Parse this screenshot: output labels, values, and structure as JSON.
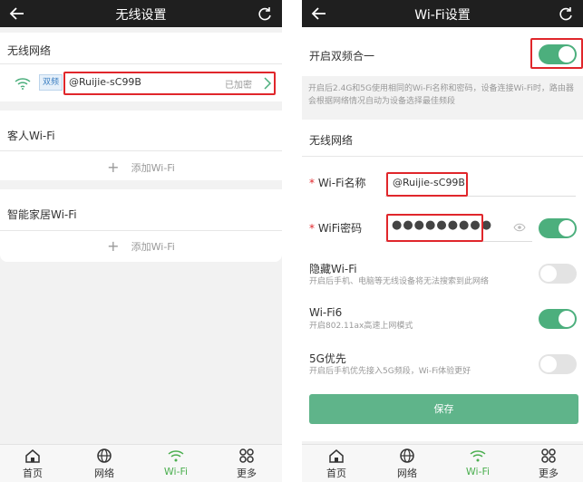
{
  "left": {
    "title": "无线设置",
    "section_wireless": "无线网络",
    "band_badge": "双频",
    "ssid": "@Ruijie-sC99B",
    "encrypted": "已加密",
    "section_guest": "客人Wi-Fi",
    "add_guest": "添加Wi-Fi",
    "section_smart": "智能家居Wi-Fi",
    "add_smart": "添加Wi-Fi"
  },
  "right": {
    "title": "Wi-Fi设置",
    "dual_band_label": "开启双频合一",
    "dual_band_desc": "开启后2.4G和5G使用相同的Wi-Fi名称和密码，设备连接Wi-Fi时，路由器会根据网络情况自动为设备选择最佳频段",
    "section_wireless": "无线网络",
    "wifi_name_label": "Wi-Fi名称",
    "wifi_name_value": "@Ruijie-sC99B",
    "wifi_pw_label": "WiFi密码",
    "wifi_pw_value": "●●●●●●●●●",
    "hide_title": "隐藏Wi-Fi",
    "hide_desc": "开启后手机、电脑等无线设备将无法搜索到此网络",
    "wifi6_title": "Wi-Fi6",
    "wifi6_desc": "开启802.11ax高速上网模式",
    "g5_title": "5G优先",
    "g5_desc": "开启后手机优先接入5G频段，Wi-Fi体验更好",
    "save_label": "保存",
    "required_mark": "*"
  },
  "toggles": {
    "dual_band": true,
    "wifi_pw": true,
    "hide_wifi": false,
    "wifi6": true,
    "g5_priority": false
  },
  "tabs": [
    {
      "label": "首页",
      "icon": "home-icon"
    },
    {
      "label": "网络",
      "icon": "globe-icon"
    },
    {
      "label": "Wi-Fi",
      "icon": "wifi-icon"
    },
    {
      "label": "更多",
      "icon": "more-icon"
    }
  ],
  "colors": {
    "accent": "#4caf7d",
    "highlight": "#e0262b"
  }
}
